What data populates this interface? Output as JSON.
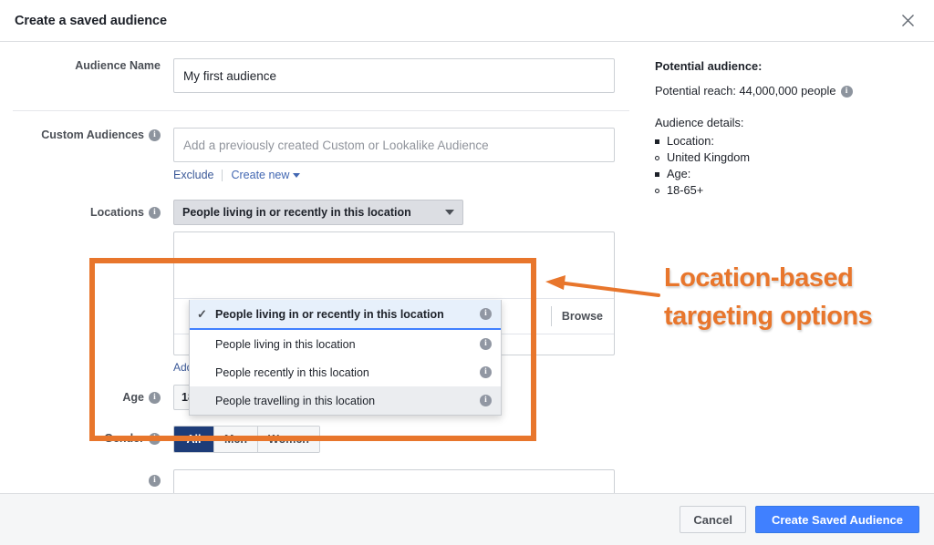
{
  "header": {
    "title": "Create a saved audience",
    "close_icon": "close-icon"
  },
  "form": {
    "audience_name": {
      "label": "Audience Name",
      "value": "My first audience"
    },
    "custom_audiences": {
      "label": "Custom Audiences",
      "placeholder": "Add a previously created Custom or Lookalike Audience",
      "exclude_label": "Exclude",
      "create_new_label": "Create new"
    },
    "locations": {
      "label": "Locations",
      "selected_option": "People living in or recently in this location",
      "browse_label": "Browse",
      "bulk_link": "Add locations in bulk",
      "dropdown_options": [
        {
          "label": "People living in or recently in this location",
          "selected": true,
          "check": "✓"
        },
        {
          "label": "People living in this location",
          "selected": false,
          "check": ""
        },
        {
          "label": "People recently in this location",
          "selected": false,
          "check": ""
        },
        {
          "label": "People travelling in this location",
          "selected": false,
          "check": ""
        }
      ]
    },
    "age": {
      "label": "Age",
      "min": "18",
      "max": "65+",
      "separator": "-"
    },
    "gender": {
      "label": "Gender",
      "options": [
        "All",
        "Men",
        "Women"
      ],
      "selected": "All"
    }
  },
  "summary": {
    "heading": "Potential audience:",
    "reach_text": "Potential reach: 44,000,000 people",
    "details_heading": "Audience details:",
    "details": [
      {
        "text": "Location:",
        "marker": "square"
      },
      {
        "text": "United Kingdom",
        "marker": "circle"
      },
      {
        "text": "Age:",
        "marker": "square"
      },
      {
        "text": "18-65+",
        "marker": "circle"
      }
    ]
  },
  "annotation": {
    "line1": "Location-based",
    "line2": "targeting options",
    "color": "#e8762c"
  },
  "footer": {
    "cancel_label": "Cancel",
    "submit_label": "Create Saved Audience"
  }
}
